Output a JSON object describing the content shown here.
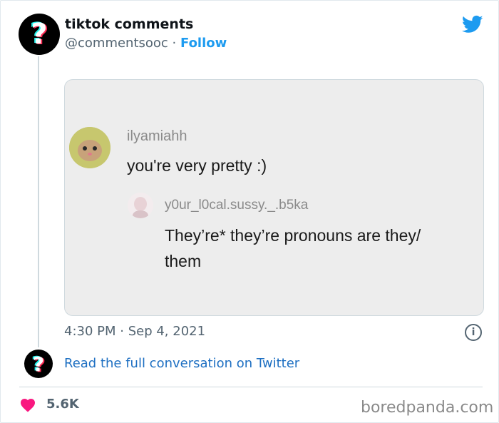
{
  "tweet": {
    "display_name": "tiktok comments",
    "handle": "@commentsooc",
    "separator": " · ",
    "follow_label": "Follow",
    "avatar_glyph": "?",
    "icon": "twitter-bird-icon",
    "time": "4:30 PM",
    "date": "Sep 4, 2021",
    "info_icon": "info-icon",
    "read_link": "Read the full conversation on Twitter",
    "likes": "5.6K",
    "like_icon": "heart-icon"
  },
  "media": {
    "comment": {
      "username": "ilyamiahh",
      "text": "you're very pretty :)",
      "avatar_icon": "cat-avatar"
    },
    "reply": {
      "username": "y0ur_l0cal.sussy._.b5ka",
      "text_line1": "They’re* they’re pronouns are they/",
      "text_line2": "them",
      "avatar_icon": "user-avatar"
    }
  },
  "watermark": "boredpanda.com",
  "colors": {
    "twitter_blue": "#1d9bf0",
    "heart_red": "#f91880",
    "tiktok_cyan": "#25f4ee",
    "tiktok_pink": "#fe2c55"
  }
}
